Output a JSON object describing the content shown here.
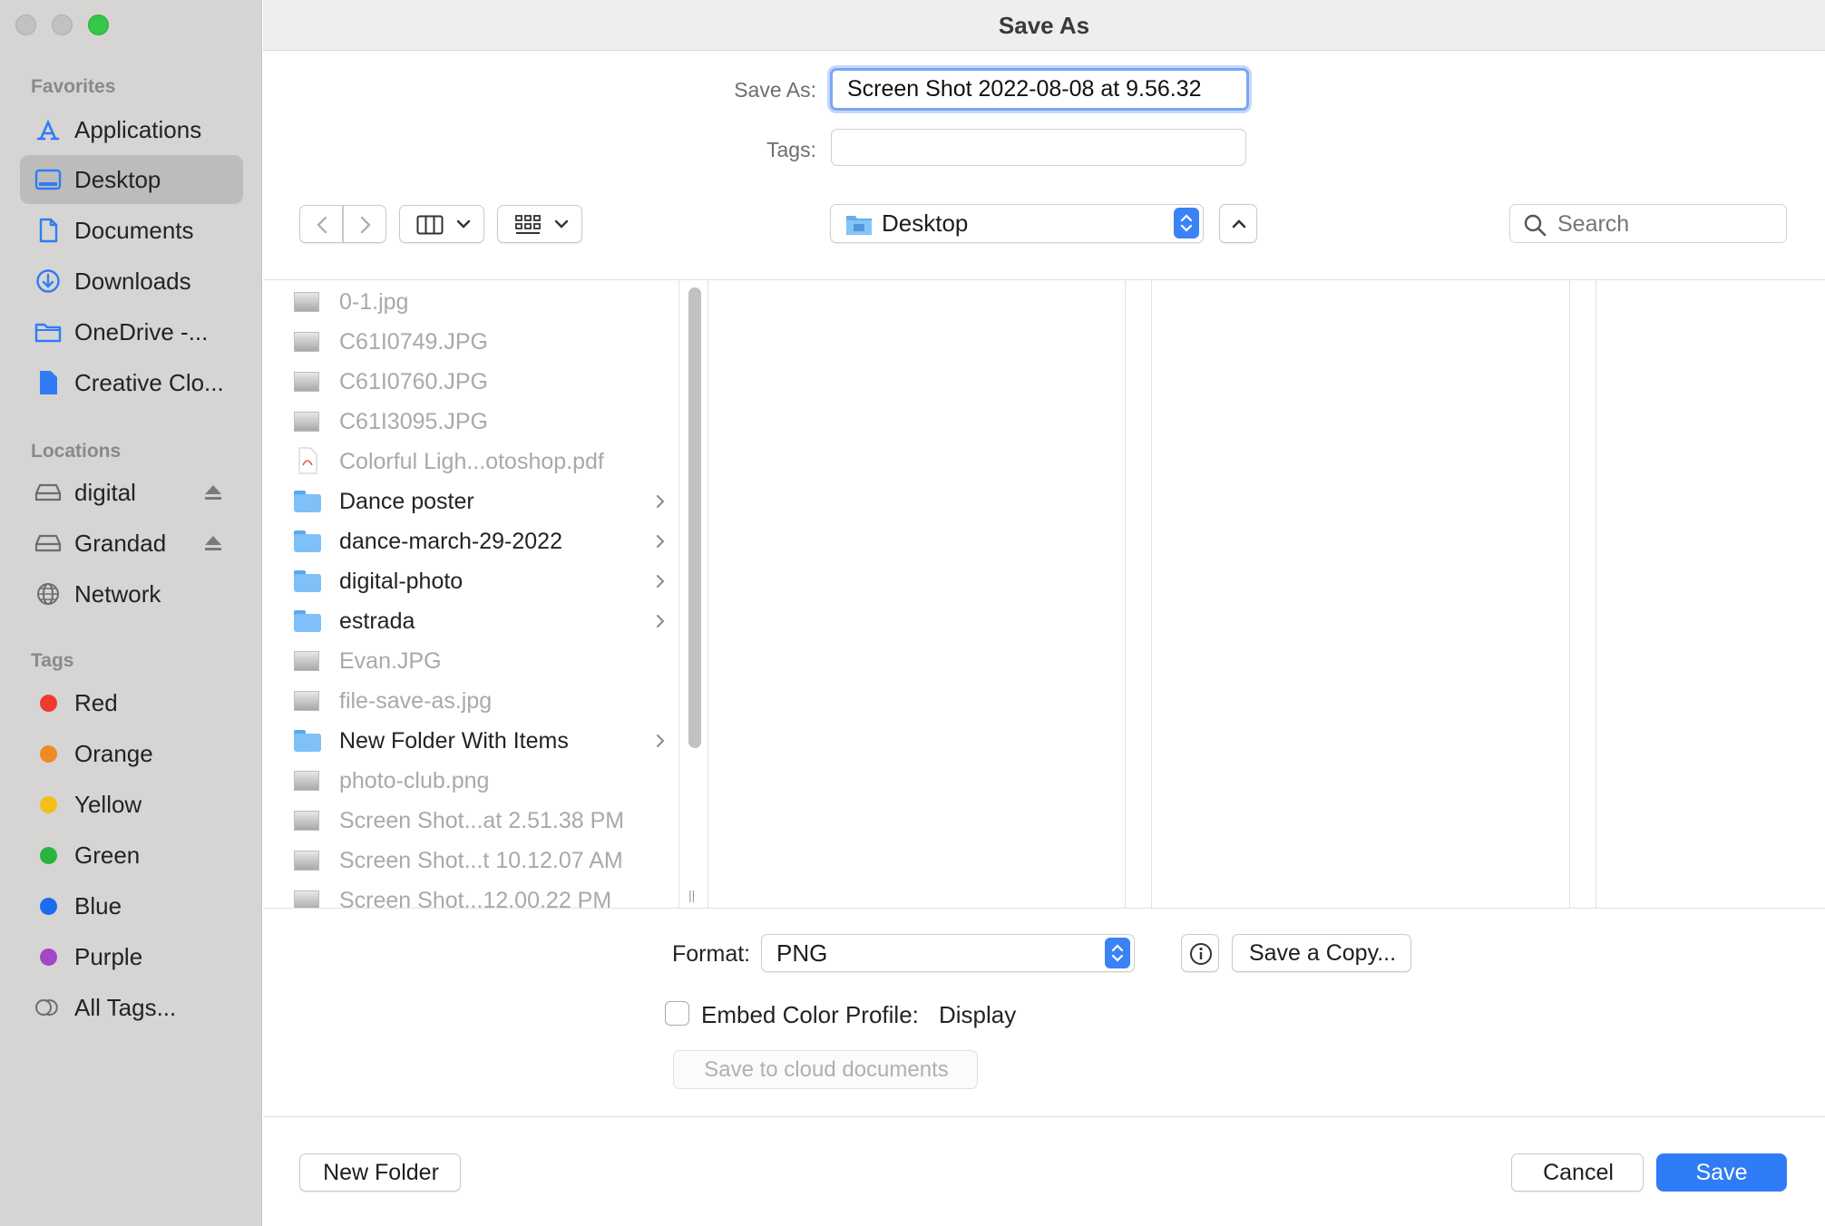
{
  "window": {
    "title": "Save As",
    "traffic_lights": [
      "#c2c1c0",
      "#c2c1c0",
      "#35c748"
    ]
  },
  "sidebar": {
    "favorites_title": "Favorites",
    "favorites": [
      {
        "label": "Applications",
        "icon": "applications-icon"
      },
      {
        "label": "Desktop",
        "icon": "desktop-icon",
        "selected": true
      },
      {
        "label": "Documents",
        "icon": "document-icon"
      },
      {
        "label": "Downloads",
        "icon": "downloads-icon"
      },
      {
        "label": "OneDrive -...",
        "icon": "folder-icon"
      },
      {
        "label": "Creative Clo...",
        "icon": "file-icon"
      }
    ],
    "locations_title": "Locations",
    "locations": [
      {
        "label": "digital",
        "icon": "drive-icon",
        "eject": true
      },
      {
        "label": "Grandad",
        "icon": "drive-icon",
        "eject": true
      },
      {
        "label": "Network",
        "icon": "network-icon"
      }
    ],
    "tags_title": "Tags",
    "tags": [
      {
        "label": "Red",
        "color": "#ee3b32"
      },
      {
        "label": "Orange",
        "color": "#f08a24"
      },
      {
        "label": "Yellow",
        "color": "#f2c019"
      },
      {
        "label": "Green",
        "color": "#29b53d"
      },
      {
        "label": "Blue",
        "color": "#1d6cf0"
      },
      {
        "label": "Purple",
        "color": "#a447c7"
      },
      {
        "label": "All Tags...",
        "color": ""
      }
    ]
  },
  "form": {
    "save_as_label": "Save As:",
    "save_as_value": "Screen Shot 2022-08-08 at 9.56.32",
    "tags_label": "Tags:",
    "tags_value": ""
  },
  "toolbar": {
    "location": "Desktop",
    "search_placeholder": "Search"
  },
  "files": [
    {
      "name": "0-1.jpg",
      "kind": "image",
      "enabled": false
    },
    {
      "name": "C61I0749.JPG",
      "kind": "image",
      "enabled": false
    },
    {
      "name": "C61I0760.JPG",
      "kind": "image",
      "enabled": false
    },
    {
      "name": "C61I3095.JPG",
      "kind": "image",
      "enabled": false
    },
    {
      "name": "Colorful Ligh...otoshop.pdf",
      "kind": "pdf",
      "enabled": false
    },
    {
      "name": "Dance poster",
      "kind": "folder",
      "enabled": true
    },
    {
      "name": "dance-march-29-2022",
      "kind": "folder",
      "enabled": true
    },
    {
      "name": "digital-photo",
      "kind": "folder",
      "enabled": true
    },
    {
      "name": "estrada",
      "kind": "folder",
      "enabled": true
    },
    {
      "name": "Evan.JPG",
      "kind": "image",
      "enabled": false
    },
    {
      "name": "file-save-as.jpg",
      "kind": "image",
      "enabled": false
    },
    {
      "name": "New Folder With Items",
      "kind": "folder",
      "enabled": true
    },
    {
      "name": "photo-club.png",
      "kind": "image",
      "enabled": false
    },
    {
      "name": "Screen Shot...at 2.51.38 PM",
      "kind": "image",
      "enabled": false
    },
    {
      "name": "Screen Shot...t 10.12.07 AM",
      "kind": "image",
      "enabled": false
    },
    {
      "name": "Screen Shot...12.00.22 PM",
      "kind": "image",
      "enabled": false
    }
  ],
  "options": {
    "format_label": "Format:",
    "format_value": "PNG",
    "save_copy_label": "Save a Copy...",
    "embed_label": "Embed Color Profile:",
    "embed_value": "Display",
    "embed_checked": false,
    "cloud_label": "Save to cloud documents"
  },
  "footer": {
    "new_folder_label": "New Folder",
    "cancel_label": "Cancel",
    "save_label": "Save"
  }
}
